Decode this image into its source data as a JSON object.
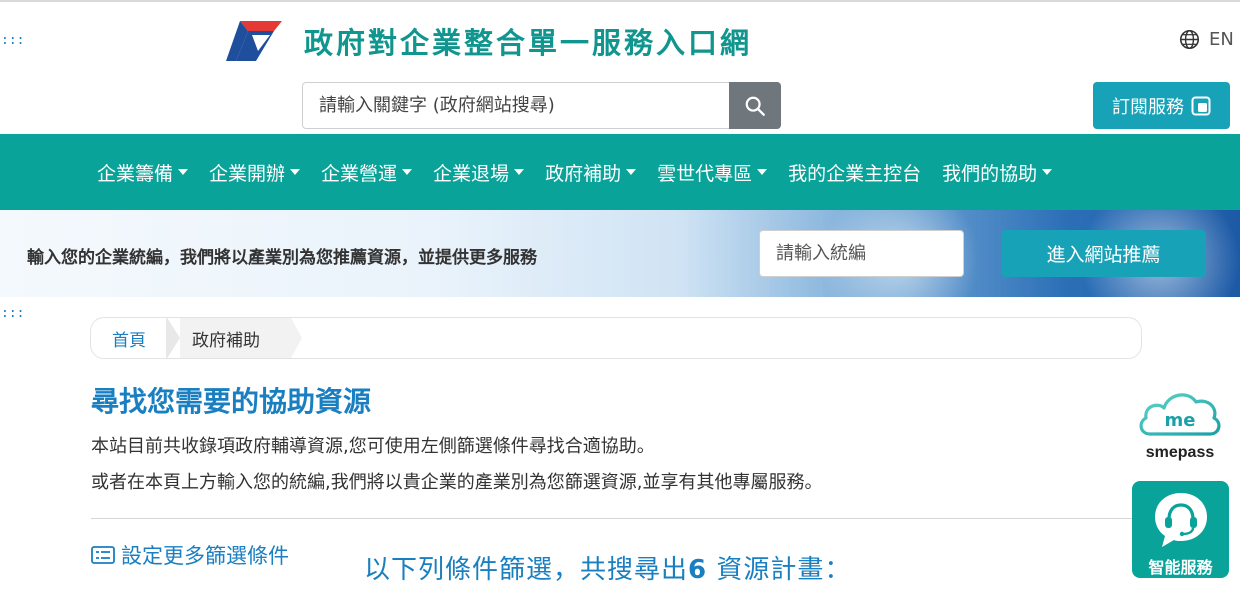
{
  "header": {
    "site_title": "政府對企業整合單一服務入口網",
    "accesskey_label": ":::",
    "language_label": "EN",
    "search_placeholder": "請輸入關鍵字 (政府網站搜尋)",
    "subscribe_label": "訂閱服務"
  },
  "nav": {
    "items": [
      {
        "label": "企業籌備",
        "has_dropdown": true
      },
      {
        "label": "企業開辦",
        "has_dropdown": true
      },
      {
        "label": "企業營運",
        "has_dropdown": true
      },
      {
        "label": "企業退場",
        "has_dropdown": true
      },
      {
        "label": "政府補助",
        "has_dropdown": true
      },
      {
        "label": "雲世代專區",
        "has_dropdown": true
      },
      {
        "label": "我的企業主控台",
        "has_dropdown": false
      },
      {
        "label": "我們的協助",
        "has_dropdown": true
      }
    ]
  },
  "banner": {
    "text": "輸入您的企業統編，我們將以產業別為您推薦資源，並提供更多服務",
    "input_placeholder": "請輸入統編",
    "button_label": "進入網站推薦"
  },
  "breadcrumb": {
    "home": "首頁",
    "current": "政府補助"
  },
  "main": {
    "accesskey_label": ":::",
    "title": "尋找您需要的協助資源",
    "desc_line1": "本站目前共收錄項政府輔導資源,您可使用左側篩選條件尋找合適協助。",
    "desc_line2": "或者在本頁上方輸入您的統編,我們將以貴企業的產業別為您篩選資源,並享有其他專屬服務。",
    "filter_link_label": "設定更多篩選條件",
    "result_prefix": "以下列條件篩選，共搜尋出",
    "result_count": "6",
    "result_suffix": " 資源計畫："
  },
  "widgets": {
    "smepass_label": "smepass",
    "ai_service_label": "智能服務"
  },
  "colors": {
    "brand_teal": "#0aa39a",
    "accent_blue": "#1a7fc1",
    "button_cyan": "#17a2b8",
    "search_button_gray": "#6f767c"
  }
}
